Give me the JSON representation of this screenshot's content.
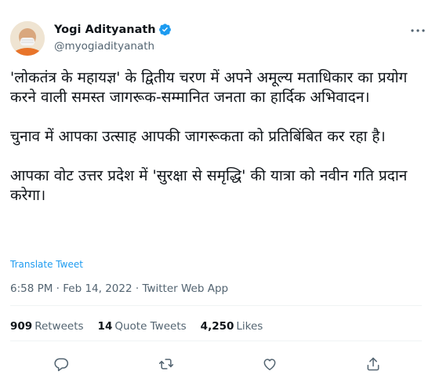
{
  "author": {
    "name": "Yogi Adityanath",
    "handle": "@myogiadityanath"
  },
  "tweet": {
    "paragraphs": [
      "'लोकतंत्र के महायज्ञ' के द्वितीय चरण में अपने अमूल्य मताधिकार का प्रयोग करने वाली समस्त जागरूक-सम्मानित जनता का हार्दिक अभिवादन।",
      "चुनाव में आपका उत्साह आपकी जागरूकता को प्रतिबिंबित कर रहा है।",
      "आपका वोट उत्तर प्रदेश में 'सुरक्षा से समृद्धि' की यात्रा को नवीन गति प्रदान करेगा।"
    ],
    "translate_label": "Translate Tweet",
    "timestamp": "6:58 PM · Feb 14, 2022 · Twitter Web App"
  },
  "stats": {
    "retweets_count": "909",
    "retweets_label": "Retweets",
    "quotes_count": "14",
    "quotes_label": "Quote Tweets",
    "likes_count": "4,250",
    "likes_label": "Likes"
  },
  "colors": {
    "accent": "#1d9bf0",
    "secondary_text": "#536471",
    "primary_text": "#0f1419"
  },
  "icons": [
    "verified-badge-icon",
    "more-icon",
    "reply-icon",
    "retweet-icon",
    "like-icon",
    "share-icon"
  ]
}
